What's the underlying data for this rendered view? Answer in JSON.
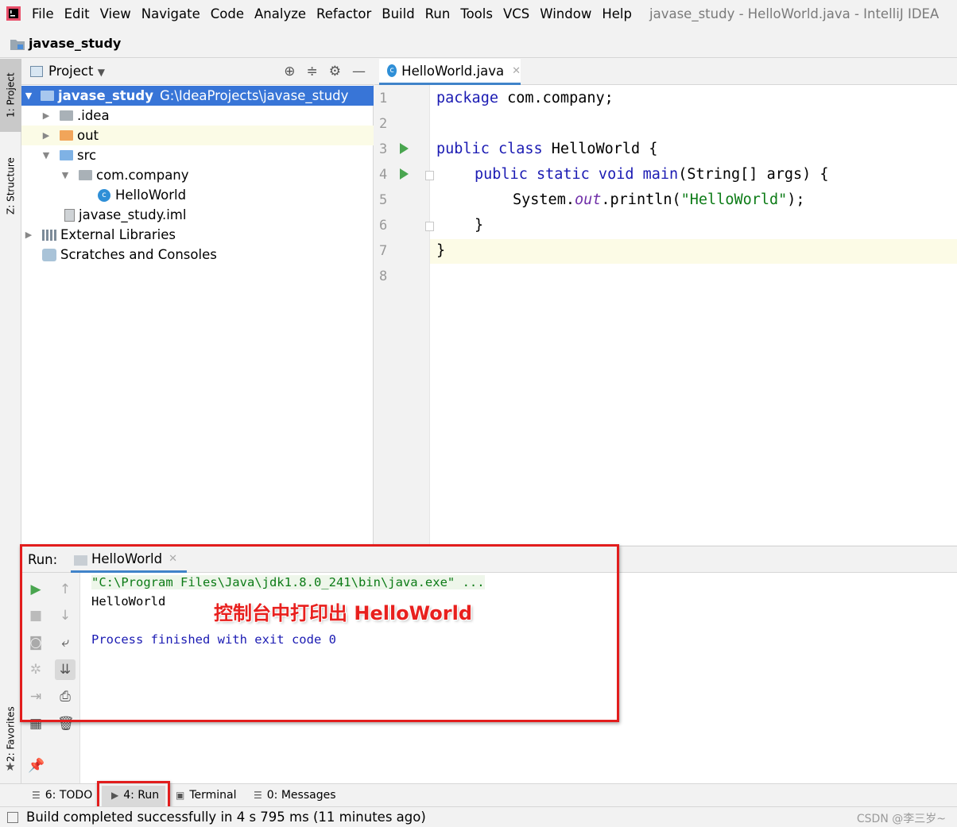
{
  "app": {
    "window_title": "javase_study - HelloWorld.java - IntelliJ IDEA",
    "menus": [
      "File",
      "Edit",
      "View",
      "Navigate",
      "Code",
      "Analyze",
      "Refactor",
      "Build",
      "Run",
      "Tools",
      "VCS",
      "Window",
      "Help"
    ]
  },
  "navbar": {
    "project": "javase_study"
  },
  "left_stripe": {
    "project_tab": "1: Project",
    "structure_tab": "Z: Structure",
    "favorites_tab": "2: Favorites"
  },
  "project_panel": {
    "title": "Project",
    "tree": [
      {
        "label": "javase_study",
        "path": "G:\\IdeaProjects\\javase_study"
      },
      {
        "label": ".idea"
      },
      {
        "label": "out"
      },
      {
        "label": "src"
      },
      {
        "label": "com.company"
      },
      {
        "label": "HelloWorld"
      },
      {
        "label": "javase_study.iml"
      },
      {
        "label": "External Libraries"
      },
      {
        "label": "Scratches and Consoles"
      }
    ]
  },
  "editor": {
    "tab": "HelloWorld.java",
    "line_numbers": [
      "1",
      "2",
      "3",
      "4",
      "5",
      "6",
      "7",
      "8"
    ],
    "code": {
      "l1_kw": "package",
      "l1_rest": " com.company;",
      "l3_kw": "public class",
      "l3_rest": " HelloWorld {",
      "l4_kw": "public static void",
      "l4_fn": " main",
      "l4_rest": "(String[] args) {",
      "l5_a": "System.",
      "l5_out": "out",
      "l5_b": ".println(",
      "l5_str": "\"HelloWorld\"",
      "l5_c": ");",
      "l6": "}",
      "l7": "}"
    }
  },
  "run_window": {
    "label": "Run:",
    "tab": "HelloWorld",
    "console": {
      "cmd": "\"C:\\Program Files\\Java\\jdk1.8.0_241\\bin\\java.exe\" ...",
      "output": "HelloWorld",
      "exit": "Process finished with exit code 0"
    },
    "annotation": "控制台中打印出 HelloWorld"
  },
  "bottom_bar": {
    "todo": "6: TODO",
    "run": "4: Run",
    "terminal": "Terminal",
    "messages": "0: Messages"
  },
  "status_bar": {
    "message": "Build completed successfully in 4 s 795 ms (11 minutes ago)",
    "watermark": "CSDN @李三岁~"
  },
  "colors": {
    "accent": "#3875d7",
    "annotation_red": "#e21d1d",
    "run_green": "#49a54f"
  }
}
